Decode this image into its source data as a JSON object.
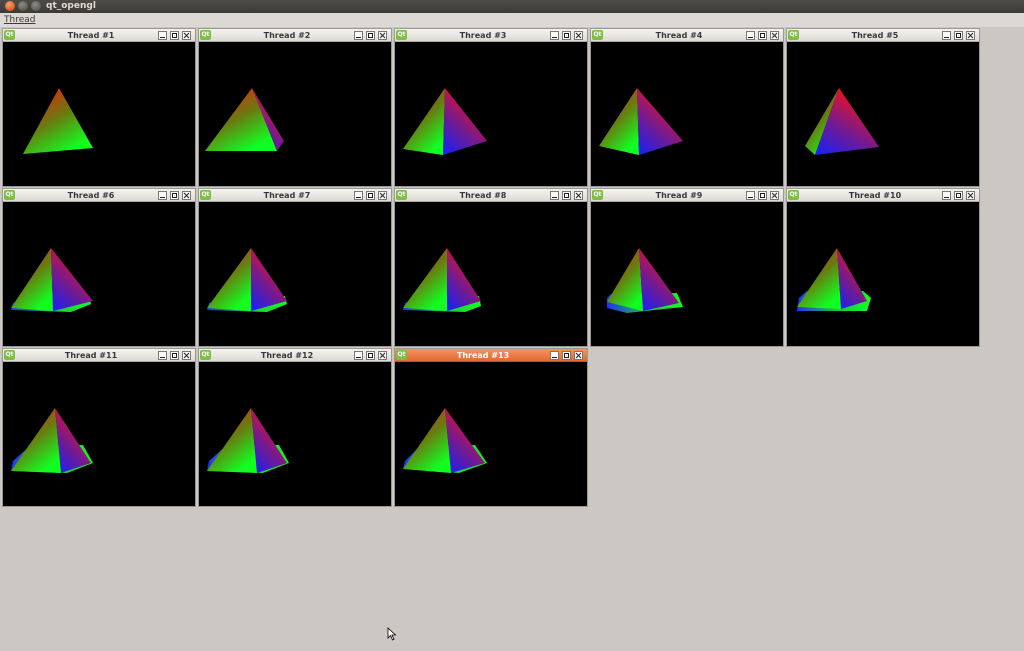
{
  "window": {
    "title": "qt_opengl"
  },
  "menu": {
    "items": [
      "Thread"
    ]
  },
  "subwindows": [
    {
      "title": "Thread #1",
      "active": false
    },
    {
      "title": "Thread #2",
      "active": false
    },
    {
      "title": "Thread #3",
      "active": false
    },
    {
      "title": "Thread #4",
      "active": false
    },
    {
      "title": "Thread #5",
      "active": false
    },
    {
      "title": "Thread #6",
      "active": false
    },
    {
      "title": "Thread #7",
      "active": false
    },
    {
      "title": "Thread #8",
      "active": false
    },
    {
      "title": "Thread #9",
      "active": false
    },
    {
      "title": "Thread #10",
      "active": false
    },
    {
      "title": "Thread #11",
      "active": false
    },
    {
      "title": "Thread #12",
      "active": false
    },
    {
      "title": "Thread #13",
      "active": true
    }
  ],
  "icons": {
    "app": "qt-icon",
    "minimize": "minimize-icon",
    "maximize": "maximize-icon",
    "close": "close-icon"
  },
  "colors": {
    "desktop": "#cbc8c4",
    "active_titlebar": "#e97440",
    "gl_background": "#000000"
  }
}
